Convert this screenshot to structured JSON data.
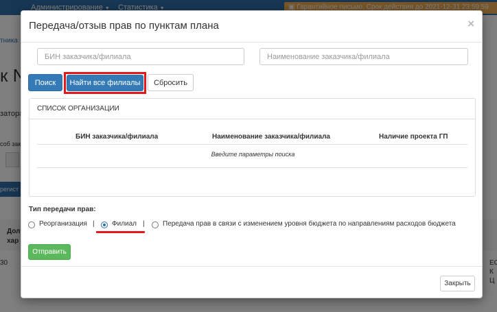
{
  "background": {
    "nav": {
      "item_1": "Администрирование",
      "item_2": "Статистика",
      "warning": "Гарантийное письмо. Срок действия до 2021-12-31 23:59:59"
    },
    "fragments": {
      "breadcrumb": "тника",
      "heading": "к N",
      "text_1": "затора",
      "text_2": "соб зак",
      "text_3": "Сб",
      "text_4": "регист",
      "col_1": "Дол",
      "col_2": "хар",
      "cell_1": "30",
      "cell_2": "ЕС",
      "cell_3": "К",
      "cell_4": "Ц"
    }
  },
  "modal": {
    "title": "Передача/отзыв прав по пунктам плана",
    "close_glyph": "×",
    "search": {
      "bin_placeholder": "БИН заказчика/филиала",
      "name_placeholder": "Наименование заказчика/филиала",
      "search_label": "Поиск",
      "find_all_label": "Найти все филиалы",
      "reset_label": "Сбросить"
    },
    "org_list": {
      "heading": "СПИСОК ОРГАНИЗАЦИИ",
      "columns": [
        "БИН заказчика/филиала",
        "Наименование заказчика/филиала",
        "Наличие проекта ГП"
      ],
      "empty_message": "Введите параметры поиска"
    },
    "transfer_type": {
      "label": "Тип передачи прав:",
      "separator": "|",
      "options": [
        {
          "label": "Реорганизация",
          "selected": false
        },
        {
          "label": "Филиал",
          "selected": true
        },
        {
          "label": "Передача прав в связи с изменением уровня бюджета по направлениям расходов бюджета",
          "selected": false
        }
      ]
    },
    "submit_label": "Отправить",
    "close_label": "Закрыть"
  },
  "colors": {
    "primary": "#337ab7",
    "success": "#5cb85c",
    "highlight": "#e4161a",
    "warning": "#f0ad4e"
  }
}
